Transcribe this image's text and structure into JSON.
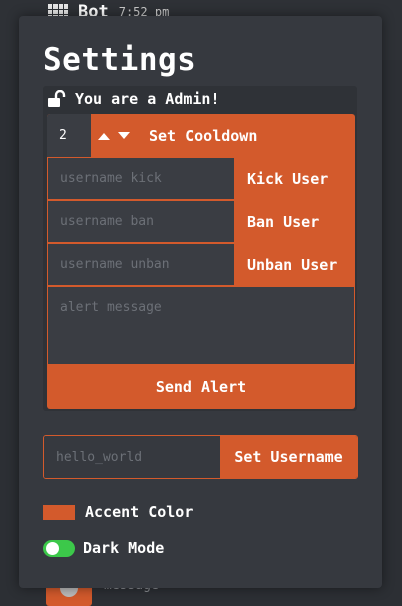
{
  "background": {
    "bot_name": "Bot",
    "bot_time": "7:52 pm",
    "message_placeholder": "message"
  },
  "modal": {
    "title": "Settings",
    "admin": {
      "status_text": "You are a Admin!",
      "cooldown": {
        "value": "2",
        "label": "Set Cooldown"
      },
      "kick": {
        "placeholder": "username kick",
        "label": "Kick User"
      },
      "ban": {
        "placeholder": "username ban",
        "label": "Ban User"
      },
      "unban": {
        "placeholder": "username unban",
        "label": "Unban User"
      },
      "alert": {
        "placeholder": "alert message",
        "label": "Send Alert"
      }
    },
    "username": {
      "placeholder": "hello_world",
      "label": "Set Username"
    },
    "accent": {
      "label": "Accent Color",
      "color": "#d35a2c"
    },
    "dark_mode": {
      "label": "Dark Mode",
      "enabled": true
    }
  },
  "colors": {
    "accent": "#d35a2c",
    "panel": "#36393f",
    "input": "#3a3d43",
    "toggle_on": "#3cc84a"
  }
}
